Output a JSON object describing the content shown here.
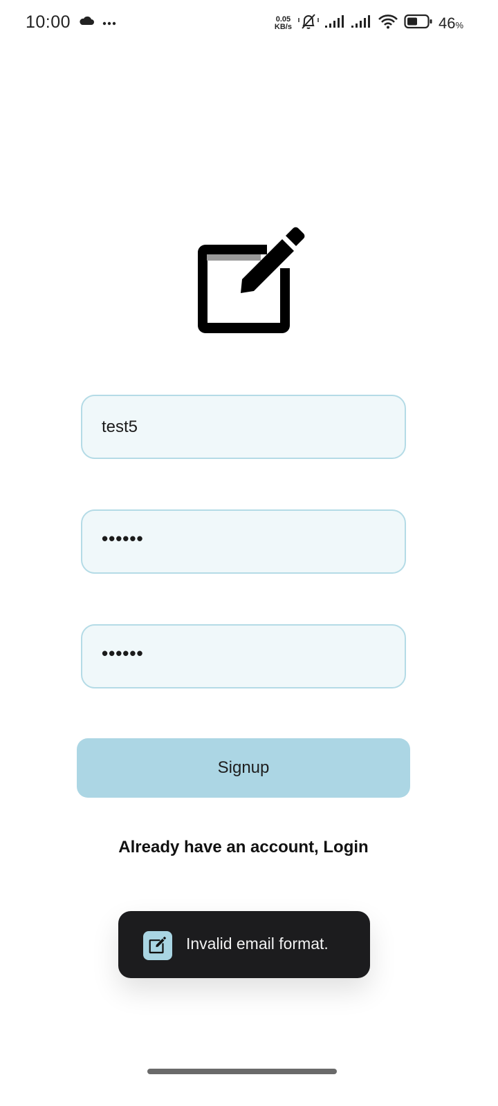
{
  "status_bar": {
    "time": "10:00",
    "net_speed_value": "0.05",
    "net_speed_unit": "KB/s",
    "battery_level": "46",
    "battery_unit": "%",
    "icons": [
      "cloud-icon",
      "more-dots-icon",
      "mute-icon",
      "signal-icon",
      "signal-icon",
      "wifi-icon",
      "battery-icon"
    ]
  },
  "logo": {
    "icon": "edit-note-icon"
  },
  "form": {
    "username_value": "test5",
    "password_value": "••••••",
    "confirm_password_value": "••••••",
    "signup_label": "Signup",
    "login_link": "Already have an account, Login"
  },
  "toast": {
    "icon": "edit-note-icon",
    "message": "Invalid email format."
  },
  "colors": {
    "input_bg": "#f0f8fa",
    "input_border": "#b4dbe6",
    "button_bg": "#acd6e4",
    "toast_bg": "#1c1c1e"
  }
}
